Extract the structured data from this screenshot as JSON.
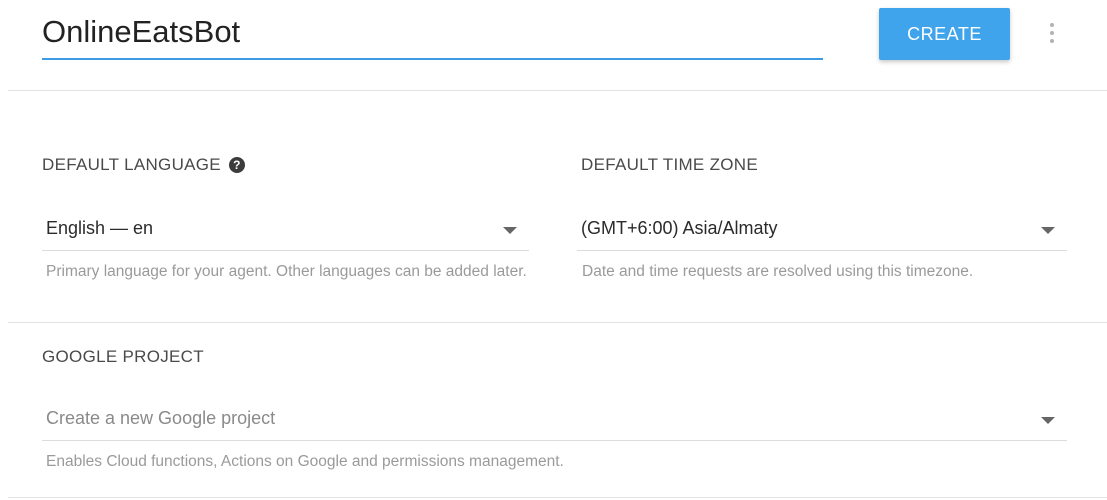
{
  "header": {
    "agent_name": "OnlineEatsBot",
    "create_label": "CREATE",
    "more_icon": "more-vert-icon"
  },
  "language": {
    "label": "DEFAULT LANGUAGE",
    "help_icon": "help-circle-icon",
    "help_glyph": "?",
    "value": "English — en",
    "hint": "Primary language for your agent. Other languages can be added later."
  },
  "timezone": {
    "label": "DEFAULT TIME ZONE",
    "value": "(GMT+6:00) Asia/Almaty",
    "hint": "Date and time requests are resolved using this timezone."
  },
  "google_project": {
    "label": "GOOGLE PROJECT",
    "placeholder": "Create a new Google project",
    "hint": "Enables Cloud functions, Actions on Google and permissions management."
  },
  "colors": {
    "accent": "#3fa4ec",
    "underline_active": "#3d9be6",
    "label_text": "#4a4a4a",
    "hint_text": "#9a9a9a"
  }
}
